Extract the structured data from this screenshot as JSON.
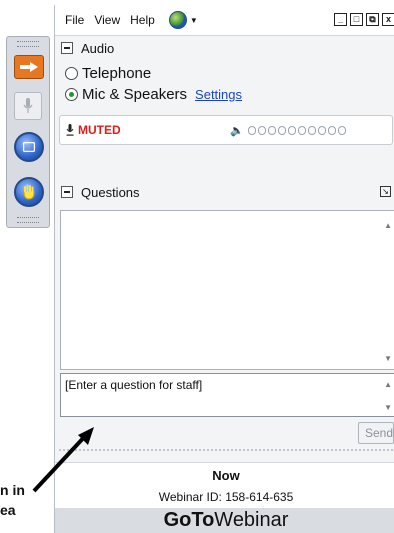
{
  "menu": {
    "file": "File",
    "view": "View",
    "help": "Help"
  },
  "window_controls": [
    "_",
    "□",
    "⧉",
    "x"
  ],
  "audio": {
    "title": "Audio",
    "telephone": "Telephone",
    "mic_speakers": "Mic & Speakers",
    "settings_link": "Settings",
    "muted": "MUTED",
    "selected_option": "Mic & Speakers",
    "level_leds": 10,
    "level_lit": 0
  },
  "questions": {
    "title": "Questions",
    "placeholder": "[Enter a question for staff]",
    "send": "Send"
  },
  "status": {
    "now": "Now",
    "webinar_id": "Webinar ID: 158-614-635"
  },
  "brand": {
    "bold": "GoTo",
    "light": "Webinar"
  },
  "annotation": {
    "line1": "n in",
    "line2": "ea"
  },
  "colors": {
    "muted": "#e01b1b",
    "accent_orange": "#e87722",
    "link": "#1a45c8"
  }
}
